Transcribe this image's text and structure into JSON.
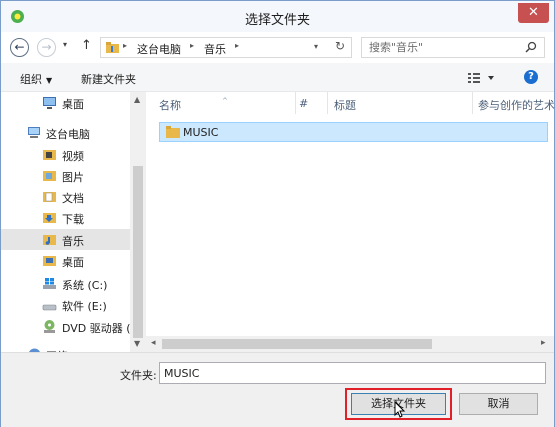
{
  "window": {
    "title": "选择文件夹",
    "close_glyph": "✕"
  },
  "address_bar": {
    "back_glyph": "←",
    "forward_glyph": "→",
    "dropdown_glyph": "▾",
    "up_glyph": "↑",
    "separator_glyph": "▸",
    "breadcrumbs": [
      "这台电脑",
      "音乐"
    ],
    "refresh_glyph": "↻"
  },
  "search": {
    "placeholder": "搜索\"音乐\""
  },
  "toolbar": {
    "organize_label": "组织",
    "organize_caret": "▼",
    "new_folder_label": "新建文件夹",
    "help_glyph": "?"
  },
  "nav_pane": {
    "scroll_up_glyph": "▲",
    "scroll_down_glyph": "▼",
    "items": [
      {
        "label": "桌面",
        "icon": "desktop-icon"
      },
      {
        "label": "这台电脑",
        "icon": "computer-icon"
      },
      {
        "label": "视频",
        "icon": "video-folder-icon"
      },
      {
        "label": "图片",
        "icon": "pictures-folder-icon"
      },
      {
        "label": "文档",
        "icon": "documents-folder-icon"
      },
      {
        "label": "下载",
        "icon": "downloads-folder-icon"
      },
      {
        "label": "音乐",
        "icon": "music-folder-icon",
        "selected": true
      },
      {
        "label": "桌面",
        "icon": "desktop-folder-icon"
      },
      {
        "label": "系统 (C:)",
        "icon": "system-drive-icon"
      },
      {
        "label": "软件 (E:)",
        "icon": "drive-icon"
      },
      {
        "label": "DVD 驱动器 (",
        "icon": "dvd-drive-icon"
      },
      {
        "label": "网络",
        "icon": "network-icon"
      }
    ]
  },
  "file_pane": {
    "columns": [
      "名称",
      "#",
      "标题",
      "参与创作的艺术"
    ],
    "sort_glyph": "^",
    "files": [
      {
        "name": "MUSIC",
        "selected": true
      }
    ],
    "hscroll_left_glyph": "◂",
    "hscroll_right_glyph": "▸"
  },
  "footer": {
    "folder_label": "文件夹:",
    "folder_value": "MUSIC",
    "select_button_label": "选择文件夹",
    "cancel_button_label": "取消"
  },
  "colors": {
    "selection_bg": "#cce8ff",
    "close_red": "#c75050",
    "highlight_red": "#e2202a",
    "folder_yellow": "#e8b84a"
  }
}
